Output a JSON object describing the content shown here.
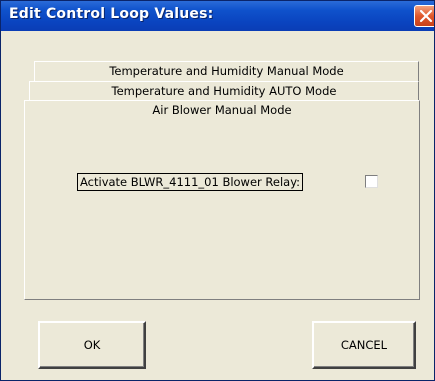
{
  "window": {
    "title": "Edit Control Loop Values:",
    "close_icon": "close-icon"
  },
  "tabs": [
    {
      "label": "Temperature and Humidity Manual Mode"
    },
    {
      "label": "Temperature and Humidity AUTO Mode"
    },
    {
      "label": "Air Blower Manual Mode",
      "active": true
    }
  ],
  "panel": {
    "relay_label": "Activate BLWR_4111_01 Blower Relay:",
    "relay_checked": false
  },
  "buttons": {
    "ok_label": "OK",
    "cancel_label": "CANCEL"
  },
  "colors": {
    "titlebar": "#0a44c0",
    "close_button": "#e0582c",
    "face": "#ece9d8"
  }
}
